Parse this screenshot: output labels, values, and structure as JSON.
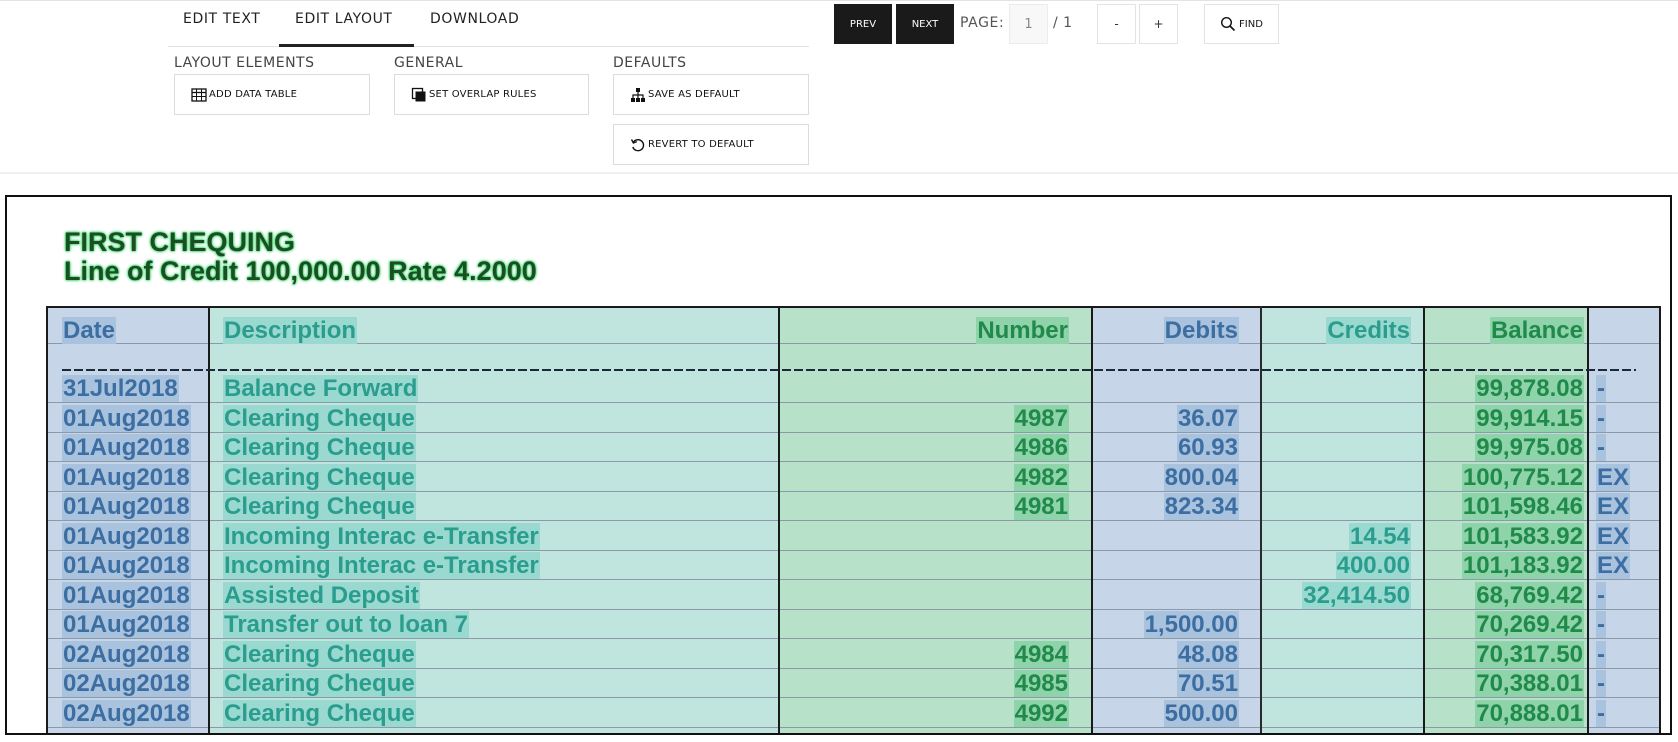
{
  "toolbar": {
    "tabs": [
      {
        "label": "EDIT TEXT"
      },
      {
        "label": "EDIT LAYOUT",
        "active": true
      },
      {
        "label": "DOWNLOAD"
      }
    ],
    "sections": {
      "layout_elements": {
        "title": "LAYOUT ELEMENTS",
        "button": "ADD DATA TABLE",
        "icon": "table-icon"
      },
      "general": {
        "title": "GENERAL",
        "button": "SET OVERLAP RULES",
        "icon": "overlap-icon"
      },
      "defaults": {
        "title": "DEFAULTS",
        "save_button": "SAVE AS DEFAULT",
        "save_icon": "hierarchy-icon",
        "revert_button": "REVERT TO DEFAULT",
        "revert_icon": "revert-icon"
      }
    },
    "nav": {
      "prev_label": "PREV",
      "next_label": "NEXT",
      "page_label": "PAGE:",
      "page_value": "1",
      "page_total": "/ 1",
      "zoom_out_label": "-",
      "zoom_in_label": "+",
      "find_label": "FIND",
      "find_icon": "search-icon"
    }
  },
  "document": {
    "title_line1": "FIRST CHEQUING",
    "title_line2": "Line of Credit 100,000.00 Rate 4.2000",
    "columns": {
      "date": "Date",
      "description": "Description",
      "number": "Number",
      "debits": "Debits",
      "credits": "Credits",
      "balance": "Balance"
    },
    "rows": [
      {
        "date": "31Jul2018",
        "description": "Balance Forward",
        "number": "",
        "debits": "",
        "credits": "",
        "balance": "99,878.08",
        "flag": "-"
      },
      {
        "date": "01Aug2018",
        "description": "Clearing Cheque",
        "number": "4987",
        "debits": "36.07",
        "credits": "",
        "balance": "99,914.15",
        "flag": "-"
      },
      {
        "date": "01Aug2018",
        "description": "Clearing Cheque",
        "number": "4986",
        "debits": "60.93",
        "credits": "",
        "balance": "99,975.08",
        "flag": "-"
      },
      {
        "date": "01Aug2018",
        "description": "Clearing Cheque",
        "number": "4982",
        "debits": "800.04",
        "credits": "",
        "balance": "100,775.12",
        "flag": "EX"
      },
      {
        "date": "01Aug2018",
        "description": "Clearing Cheque",
        "number": "4981",
        "debits": "823.34",
        "credits": "",
        "balance": "101,598.46",
        "flag": "EX"
      },
      {
        "date": "01Aug2018",
        "description": "Incoming Interac e-Transfer",
        "number": "",
        "debits": "",
        "credits": "14.54",
        "balance": "101,583.92",
        "flag": "EX"
      },
      {
        "date": "01Aug2018",
        "description": "Incoming Interac e-Transfer",
        "number": "",
        "debits": "",
        "credits": "400.00",
        "balance": "101,183.92",
        "flag": "EX"
      },
      {
        "date": "01Aug2018",
        "description": "Assisted Deposit",
        "number": "",
        "debits": "",
        "credits": "32,414.50",
        "balance": "68,769.42",
        "flag": "-"
      },
      {
        "date": "01Aug2018",
        "description": "Transfer out  to loan 7",
        "number": "",
        "debits": "1,500.00",
        "credits": "",
        "balance": "70,269.42",
        "flag": "-"
      },
      {
        "date": "02Aug2018",
        "description": "Clearing Cheque",
        "number": "4984",
        "debits": "48.08",
        "credits": "",
        "balance": "70,317.50",
        "flag": "-"
      },
      {
        "date": "02Aug2018",
        "description": "Clearing Cheque",
        "number": "4985",
        "debits": "70.51",
        "credits": "",
        "balance": "70,388.01",
        "flag": "-"
      },
      {
        "date": "02Aug2018",
        "description": "Clearing Cheque",
        "number": "4992",
        "debits": "500.00",
        "credits": "",
        "balance": "70,888.01",
        "flag": "-"
      }
    ],
    "colors": {
      "date_region": "#c6d6e8",
      "description_region": "#bfe5de",
      "number_region": "#b8e1c9",
      "title_glow": "#22d35a"
    }
  }
}
